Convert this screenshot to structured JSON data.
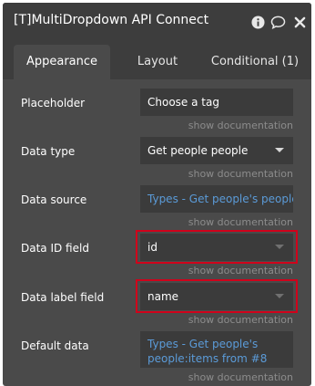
{
  "header": {
    "title": "[T]MultiDropdown API Connecto",
    "icons": [
      "info-icon",
      "comment-icon",
      "close-icon"
    ]
  },
  "tabs": [
    {
      "label": "Appearance",
      "active": true
    },
    {
      "label": "Layout",
      "active": false
    },
    {
      "label": "Conditional (1)",
      "active": false
    }
  ],
  "doc_link": "show documentation",
  "fields": {
    "placeholder": {
      "label": "Placeholder",
      "value": "Choose a tag"
    },
    "data_type": {
      "label": "Data type",
      "value": "Get people people"
    },
    "data_source": {
      "label": "Data source",
      "value": "Types - Get people's people"
    },
    "data_id_field": {
      "label": "Data ID field",
      "value": "id"
    },
    "data_label_field": {
      "label": "Data label field",
      "value": "name"
    },
    "default_data": {
      "label": "Default data",
      "value": "Types - Get people's people:items from #8"
    }
  },
  "colors": {
    "panel": "#4a4a4a",
    "header": "#3d3d3d",
    "field": "#3b3b3b",
    "link": "#5b9bd8",
    "highlight": "#d0021b"
  }
}
